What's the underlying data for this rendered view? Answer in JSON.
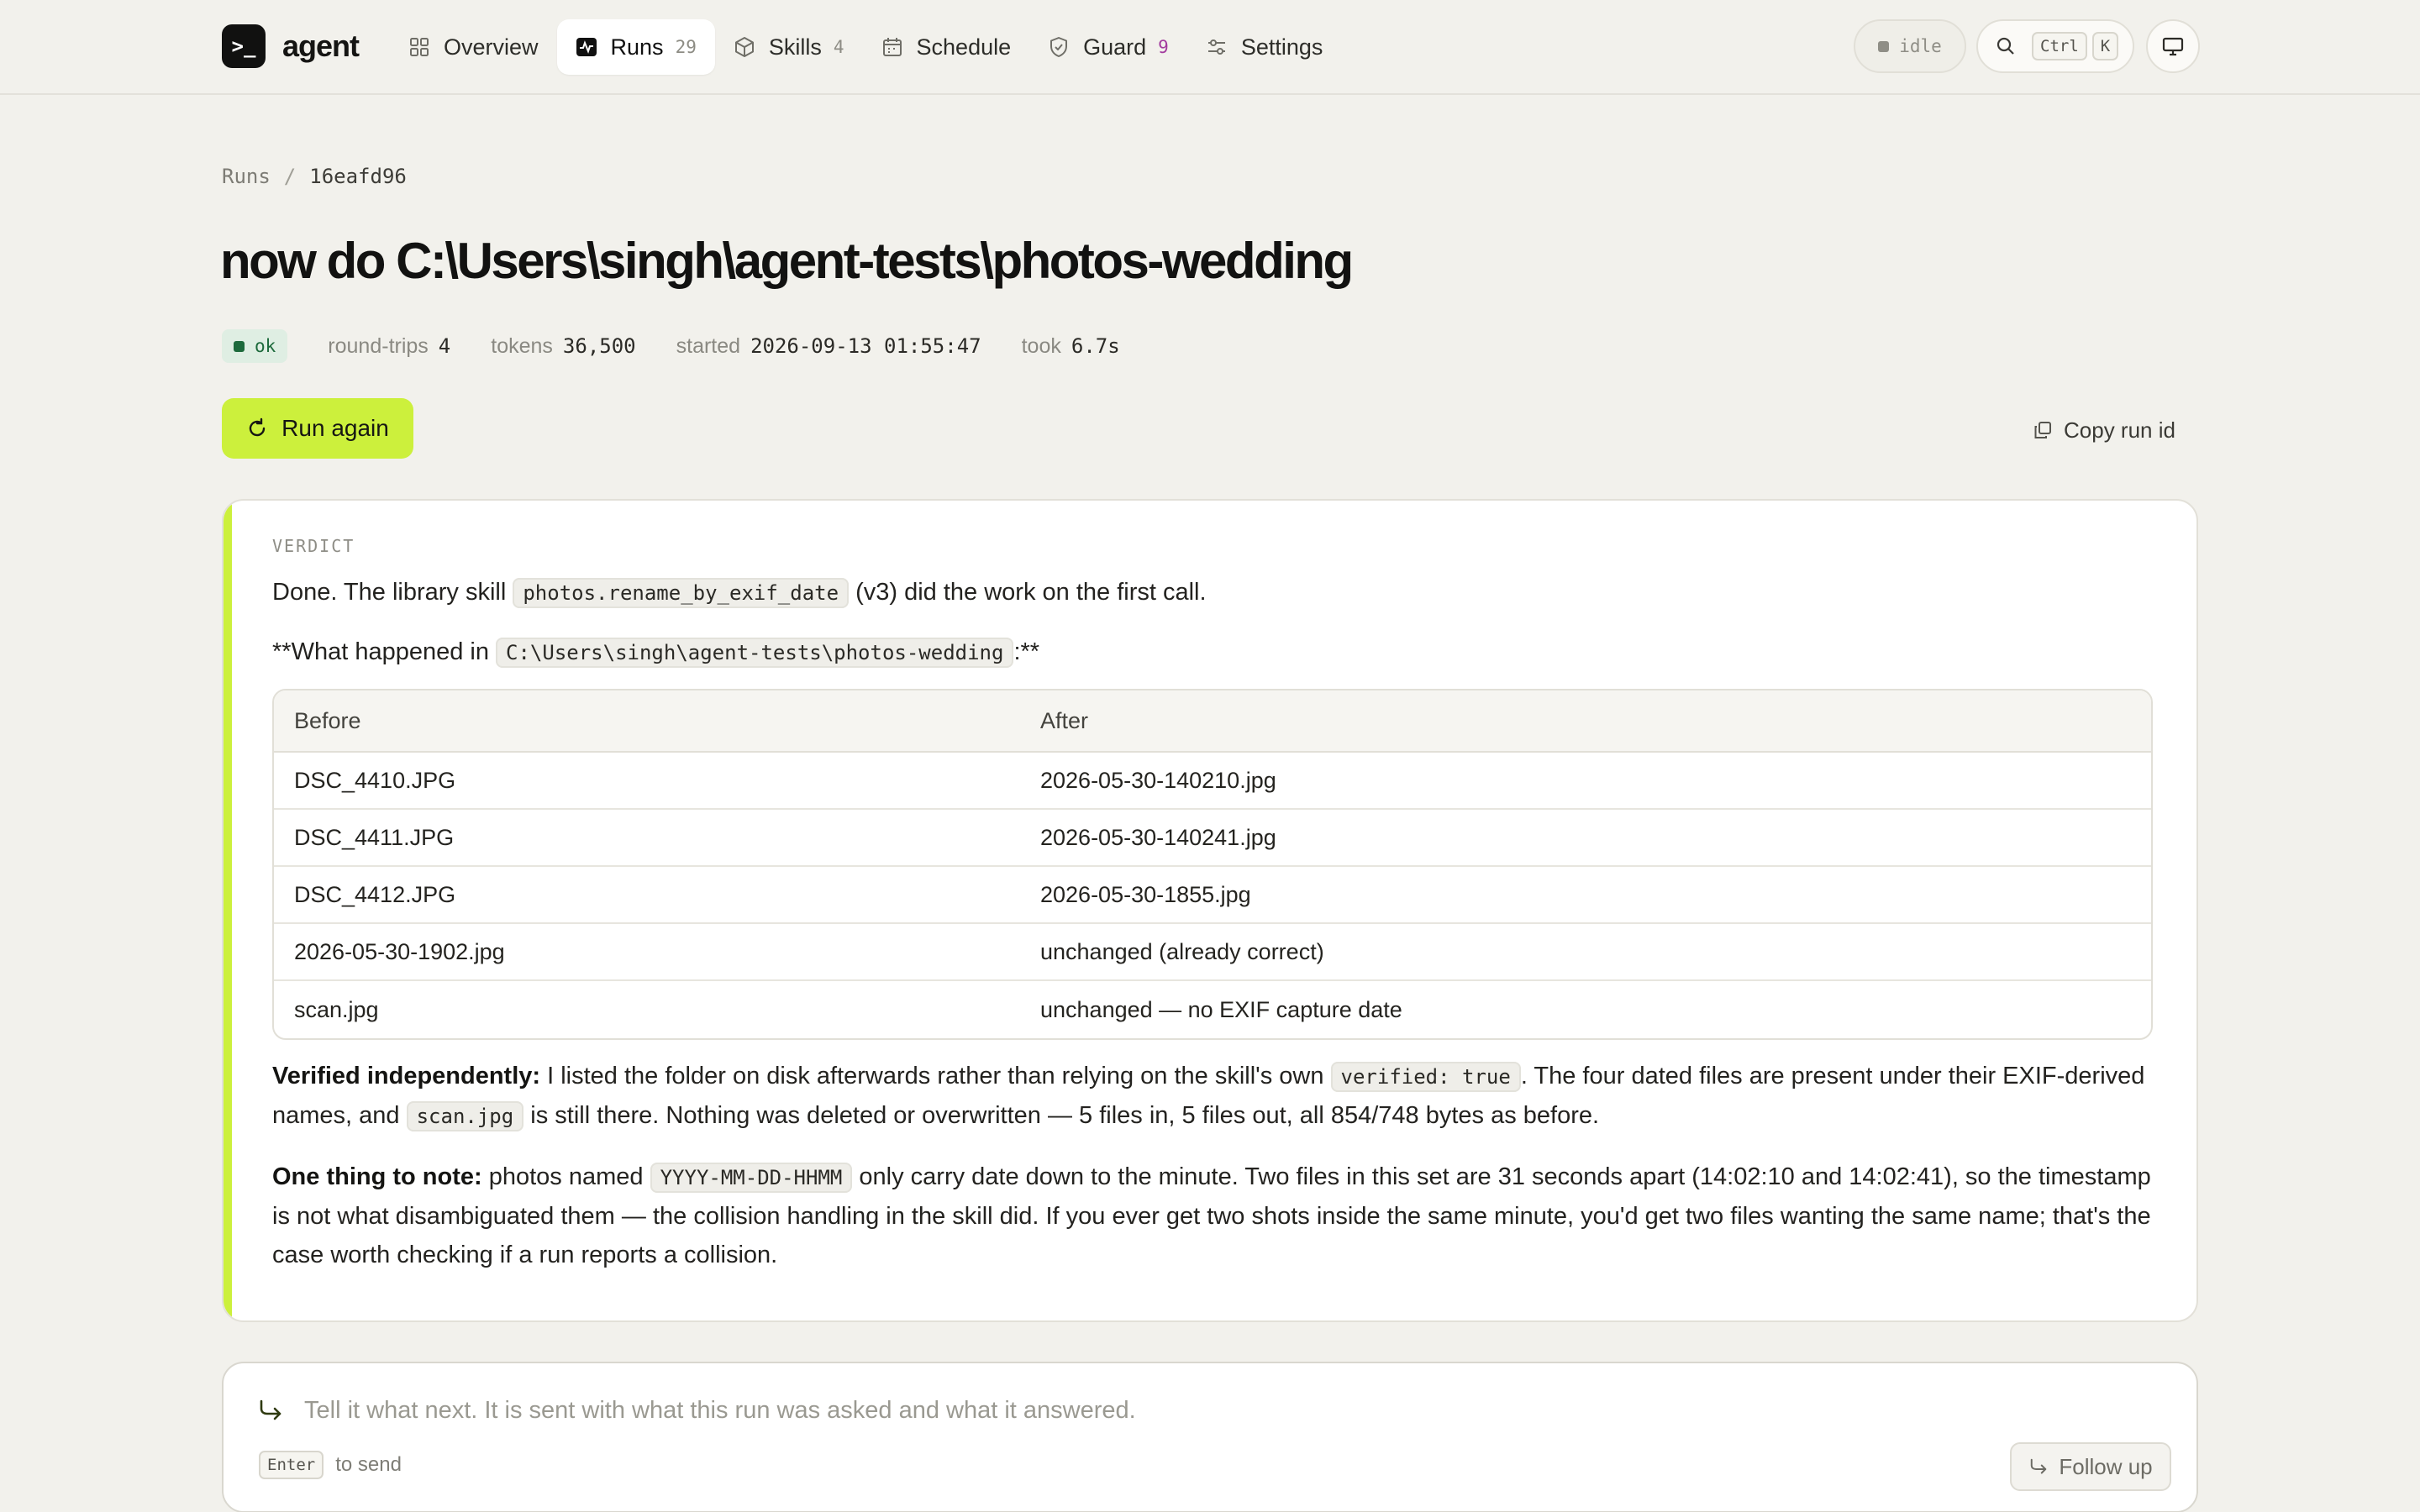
{
  "brand": {
    "mark": ">_",
    "name": "agent"
  },
  "nav": {
    "overview": {
      "label": "Overview"
    },
    "runs": {
      "label": "Runs",
      "count": "29"
    },
    "skills": {
      "label": "Skills",
      "count": "4"
    },
    "schedule": {
      "label": "Schedule"
    },
    "guard": {
      "label": "Guard",
      "count": "9"
    },
    "settings": {
      "label": "Settings"
    }
  },
  "status": {
    "label": "idle"
  },
  "search": {
    "key1": "Ctrl",
    "key2": "K"
  },
  "breadcrumb": {
    "root": "Runs",
    "separator": "/",
    "current": "16eafd96"
  },
  "run": {
    "title": "now do C:\\Users\\singh\\agent-tests\\photos-wedding",
    "status": "ok",
    "round_trips_label": "round-trips",
    "round_trips": "4",
    "tokens_label": "tokens",
    "tokens": "36,500",
    "started_label": "started",
    "started": "2026-09-13 01:55:47",
    "took_label": "took",
    "took": "6.7s"
  },
  "actions": {
    "run_again": "Run again",
    "copy_run_id": "Copy run id"
  },
  "verdict": {
    "label": "VERDICT",
    "p1": {
      "a": "Done. The library skill ",
      "code": "photos.rename_by_exif_date",
      "b": " (v3) did the work on the first call."
    },
    "p2": {
      "a": "**What happened in ",
      "code": "C:\\Users\\singh\\agent-tests\\photos-wedding",
      "b": ":**"
    },
    "table": {
      "headers": [
        "Before",
        "After"
      ],
      "rows": [
        [
          "DSC_4410.JPG",
          "2026-05-30-140210.jpg"
        ],
        [
          "DSC_4411.JPG",
          "2026-05-30-140241.jpg"
        ],
        [
          "DSC_4412.JPG",
          "2026-05-30-1855.jpg"
        ],
        [
          "2026-05-30-1902.jpg",
          "unchanged (already correct)"
        ],
        [
          "scan.jpg",
          "unchanged — no EXIF capture date"
        ]
      ]
    },
    "p3": {
      "lead": "Verified independently:",
      "a": " I listed the folder on disk afterwards rather than relying on the skill's own ",
      "code1": "verified: true",
      "b": ". The four dated files are present under their EXIF-derived names, and ",
      "code2": "scan.jpg",
      "c": " is still there. Nothing was deleted or overwritten — 5 files in, 5 files out, all 854/748 bytes as before."
    },
    "p4": {
      "lead": "One thing to note:",
      "a": " photos named ",
      "code": "YYYY-MM-DD-HHMM",
      "b": " only carry date down to the minute. Two files in this set are 31 seconds apart (14:02:10 and 14:02:41), so the timestamp is not what disambiguated them — the collision handling in the skill did. If you ever get two shots inside the same minute, you'd get two files wanting the same name; that's the case worth checking if a run reports a collision."
    }
  },
  "composer": {
    "placeholder": "Tell it what next. It is sent with what this run was asked and what it answered.",
    "value": "",
    "send_key": "Enter",
    "send_hint": "to send",
    "follow_up": "Follow up"
  },
  "colors": {
    "accent": "#ccf03c",
    "background": "#f2f1ec",
    "ok_bg": "#dfeee3",
    "ok_fg": "#1d6a3c",
    "guard_count": "#a23a9e"
  }
}
